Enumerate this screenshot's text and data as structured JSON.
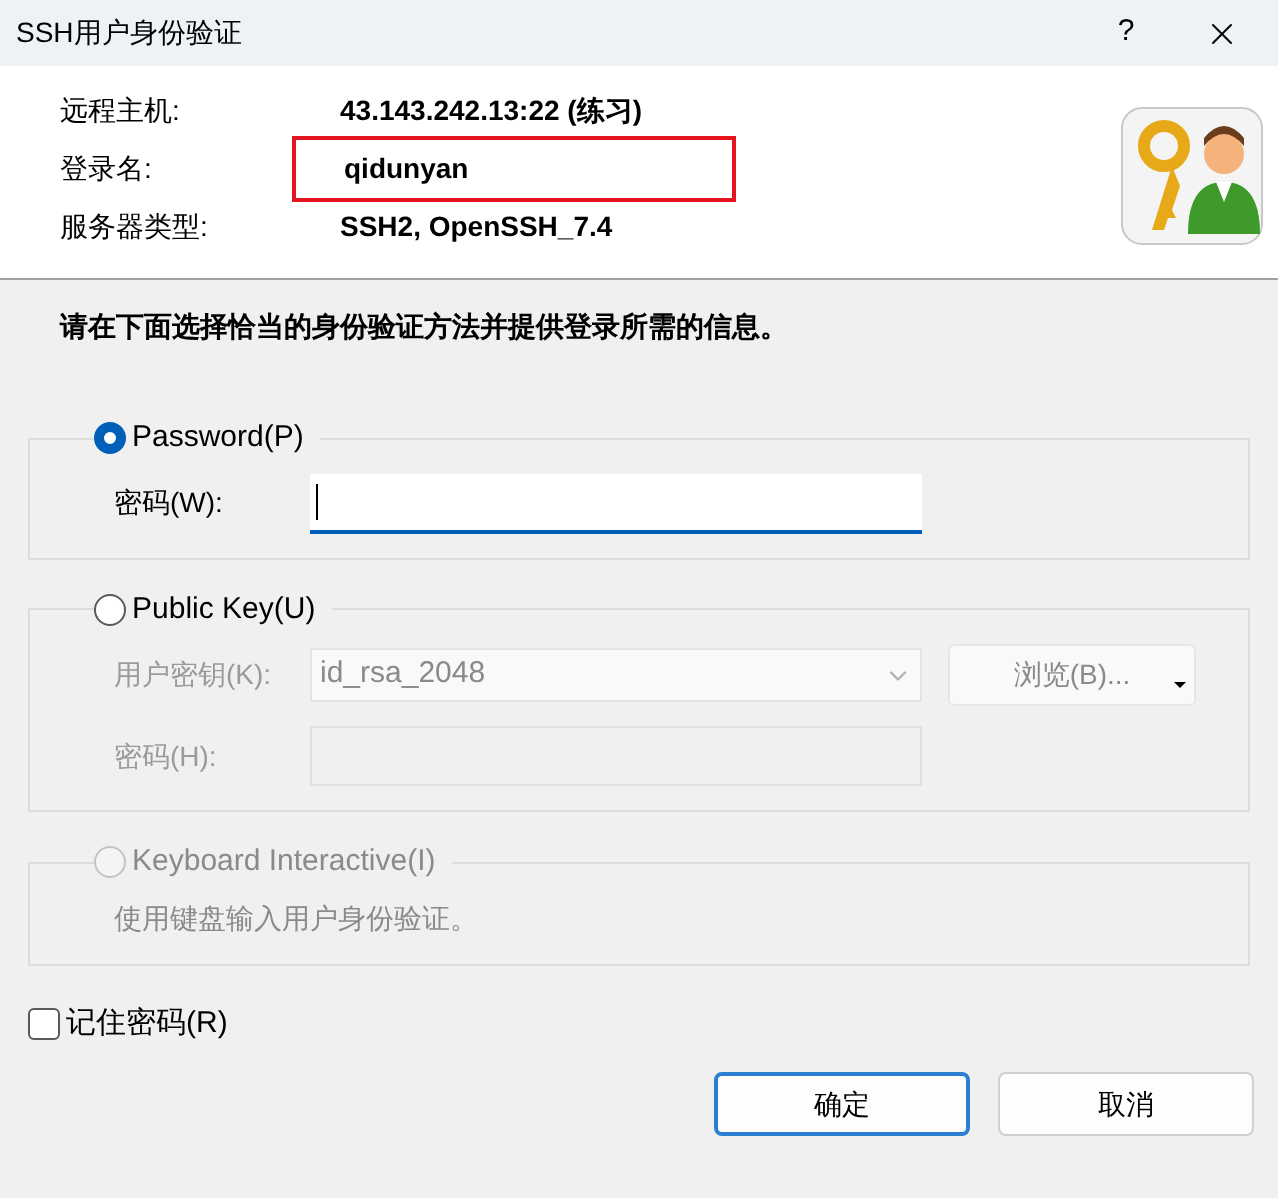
{
  "window": {
    "title": "SSH用户身份验证",
    "help_button": "?"
  },
  "info": [
    {
      "label": "远程主机:",
      "value": "43.143.242.13:22 (练习)",
      "highlighted": false
    },
    {
      "label": "登录名:",
      "value": "qidunyan",
      "highlighted": true
    },
    {
      "label": "服务器类型:",
      "value": "SSH2, OpenSSH_7.4",
      "highlighted": false
    }
  ],
  "instruction": "请在下面选择恰当的身份验证方法并提供登录所需的信息。",
  "methods": [
    {
      "kind": "password",
      "label": "Password(P)",
      "selected": true,
      "disabled": false,
      "fields": [
        {
          "kind": "text",
          "label": "密码(W):",
          "disabled": false,
          "focused": true
        }
      ]
    },
    {
      "kind": "publickey",
      "label": "Public Key(U)",
      "selected": false,
      "disabled": false,
      "fields": [
        {
          "kind": "select",
          "label": "用户密钥(K):",
          "value": "id_rsa_2048",
          "disabled": true,
          "button": "浏览(B)..."
        },
        {
          "kind": "text",
          "label": "密码(H):",
          "disabled": true
        }
      ]
    },
    {
      "kind": "keyboard",
      "label": "Keyboard Interactive(I)",
      "selected": false,
      "disabled": true,
      "description": "使用键盘输入用户身份验证。"
    }
  ],
  "remember": {
    "label": "记住密码(R)",
    "checked": false
  },
  "buttons": [
    {
      "label": "确定",
      "default": true
    },
    {
      "label": "取消",
      "default": false
    }
  ]
}
